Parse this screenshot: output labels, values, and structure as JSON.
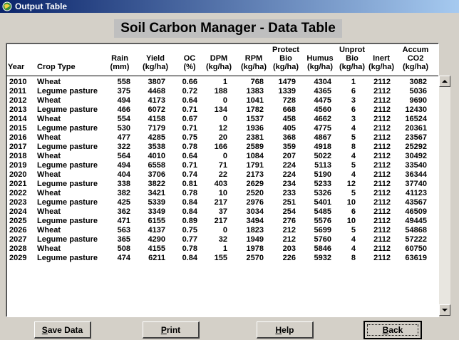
{
  "window": {
    "title": "Output Table",
    "icon": "app-icon"
  },
  "heading": "Soil Carbon Manager - Data Table",
  "columns": {
    "year": [
      "Year"
    ],
    "crop": [
      "Crop Type"
    ],
    "rain": [
      "Rain",
      "(mm)"
    ],
    "yield": [
      "Yield",
      "(kg/ha)"
    ],
    "oc": [
      "OC",
      "(%)"
    ],
    "dpm": [
      "DPM",
      "(kg/ha)"
    ],
    "rpm": [
      "RPM",
      "(kg/ha)"
    ],
    "prot": [
      "Protect",
      "Bio",
      "(kg/ha)"
    ],
    "humus": [
      "Humus",
      "(kg/ha)"
    ],
    "unpr": [
      "Unprot",
      "Bio",
      "(kg/ha)"
    ],
    "inert": [
      "Inert",
      "(kg/ha)"
    ],
    "accum": [
      "Accum",
      "CO2",
      "(kg/ha)"
    ]
  },
  "rows": [
    [
      "2010",
      "Wheat",
      "558",
      "3807",
      "0.66",
      "1",
      "768",
      "1479",
      "4304",
      "1",
      "2112",
      "3082"
    ],
    [
      "2011",
      "Legume pasture",
      "375",
      "4468",
      "0.72",
      "188",
      "1383",
      "1339",
      "4365",
      "6",
      "2112",
      "5036"
    ],
    [
      "2012",
      "Wheat",
      "494",
      "4173",
      "0.64",
      "0",
      "1041",
      "728",
      "4475",
      "3",
      "2112",
      "9690"
    ],
    [
      "2013",
      "Legume pasture",
      "466",
      "6072",
      "0.71",
      "134",
      "1782",
      "668",
      "4560",
      "6",
      "2112",
      "12430"
    ],
    [
      "2014",
      "Wheat",
      "554",
      "4158",
      "0.67",
      "0",
      "1537",
      "458",
      "4662",
      "3",
      "2112",
      "16524"
    ],
    [
      "2015",
      "Legume pasture",
      "530",
      "7179",
      "0.71",
      "12",
      "1936",
      "405",
      "4775",
      "4",
      "2112",
      "20361"
    ],
    [
      "2016",
      "Wheat",
      "477",
      "4285",
      "0.75",
      "20",
      "2381",
      "368",
      "4867",
      "5",
      "2112",
      "23567"
    ],
    [
      "2017",
      "Legume pasture",
      "322",
      "3538",
      "0.78",
      "166",
      "2589",
      "359",
      "4918",
      "8",
      "2112",
      "25292"
    ],
    [
      "2018",
      "Wheat",
      "564",
      "4010",
      "0.64",
      "0",
      "1084",
      "207",
      "5022",
      "4",
      "2112",
      "30492"
    ],
    [
      "2019",
      "Legume pasture",
      "494",
      "6558",
      "0.71",
      "71",
      "1791",
      "224",
      "5113",
      "5",
      "2112",
      "33540"
    ],
    [
      "2020",
      "Wheat",
      "404",
      "3706",
      "0.74",
      "22",
      "2173",
      "224",
      "5190",
      "4",
      "2112",
      "36344"
    ],
    [
      "2021",
      "Legume pasture",
      "338",
      "3822",
      "0.81",
      "403",
      "2629",
      "234",
      "5233",
      "12",
      "2112",
      "37740"
    ],
    [
      "2022",
      "Wheat",
      "382",
      "3421",
      "0.78",
      "10",
      "2520",
      "233",
      "5326",
      "5",
      "2112",
      "41123"
    ],
    [
      "2023",
      "Legume pasture",
      "425",
      "5339",
      "0.84",
      "217",
      "2976",
      "251",
      "5401",
      "10",
      "2112",
      "43567"
    ],
    [
      "2024",
      "Wheat",
      "362",
      "3349",
      "0.84",
      "37",
      "3034",
      "254",
      "5485",
      "6",
      "2112",
      "46509"
    ],
    [
      "2025",
      "Legume pasture",
      "471",
      "6155",
      "0.89",
      "217",
      "3494",
      "276",
      "5576",
      "10",
      "2112",
      "49445"
    ],
    [
      "2026",
      "Wheat",
      "563",
      "4137",
      "0.75",
      "0",
      "1823",
      "212",
      "5699",
      "5",
      "2112",
      "54868"
    ],
    [
      "2027",
      "Legume pasture",
      "365",
      "4290",
      "0.77",
      "32",
      "1949",
      "212",
      "5760",
      "4",
      "2112",
      "57222"
    ],
    [
      "2028",
      "Wheat",
      "508",
      "4155",
      "0.78",
      "1",
      "1978",
      "203",
      "5846",
      "4",
      "2112",
      "60750"
    ],
    [
      "2029",
      "Legume pasture",
      "474",
      "6211",
      "0.84",
      "155",
      "2570",
      "226",
      "5932",
      "8",
      "2112",
      "63619"
    ]
  ],
  "buttons": {
    "save": {
      "accel": "S",
      "rest": "ave Data"
    },
    "print": {
      "accel": "P",
      "rest": "rint"
    },
    "help": {
      "accel": "H",
      "rest": "elp"
    },
    "back": {
      "accel": "B",
      "rest": "ack"
    }
  }
}
